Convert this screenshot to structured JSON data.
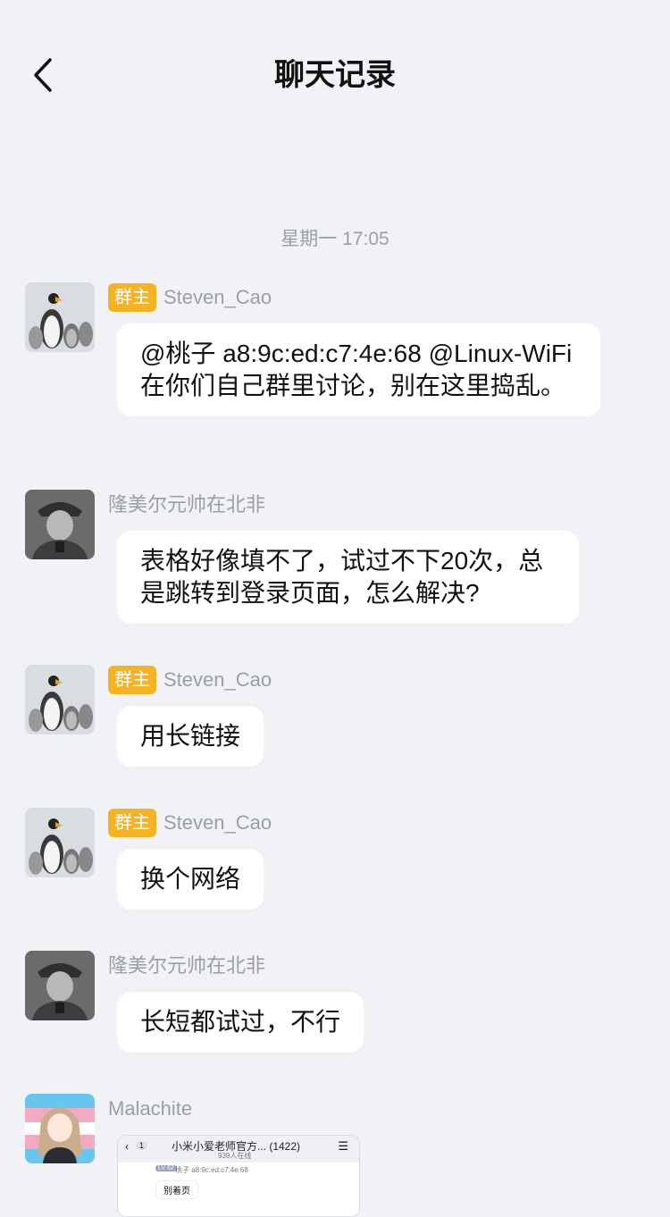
{
  "header": {
    "title": "聊天记录"
  },
  "timestamp": "星期一 17:05",
  "messages": [
    {
      "sender": "Steven_Cao",
      "badge": "群主",
      "avatar": "penguin-avatar",
      "text": "@桃子 a8:9c:ed:c7:4e:68 @Linux-WiFi 在你们自己群里讨论，别在这里捣乱。"
    },
    {
      "sender": "隆美尔元帅在北非",
      "badge": "",
      "avatar": "officer-avatar",
      "text": "表格好像填不了，试过不下20次，总是跳转到登录页面，怎么解决?"
    },
    {
      "sender": "Steven_Cao",
      "badge": "群主",
      "avatar": "penguin-avatar",
      "text": "用长链接"
    },
    {
      "sender": "Steven_Cao",
      "badge": "群主",
      "avatar": "penguin-avatar",
      "text": "换个网络"
    },
    {
      "sender": "隆美尔元帅在北非",
      "badge": "",
      "avatar": "officer-avatar",
      "text": "长短都试过，不行"
    },
    {
      "sender": "Malachite",
      "badge": "",
      "avatar": "anime-avatar",
      "image": {
        "group_title": "小米小爱老师官方... (1422)",
        "online": "939人在线",
        "back_count": "1",
        "level": "LV 62",
        "user": "桃子 a8:9c:ed:c7:4e:68",
        "reply": "别着页"
      }
    }
  ],
  "colors": {
    "background": "#f1f2f6",
    "badge": "#f5b324",
    "meta_text": "#9b9ea8",
    "bubble": "#ffffff"
  }
}
